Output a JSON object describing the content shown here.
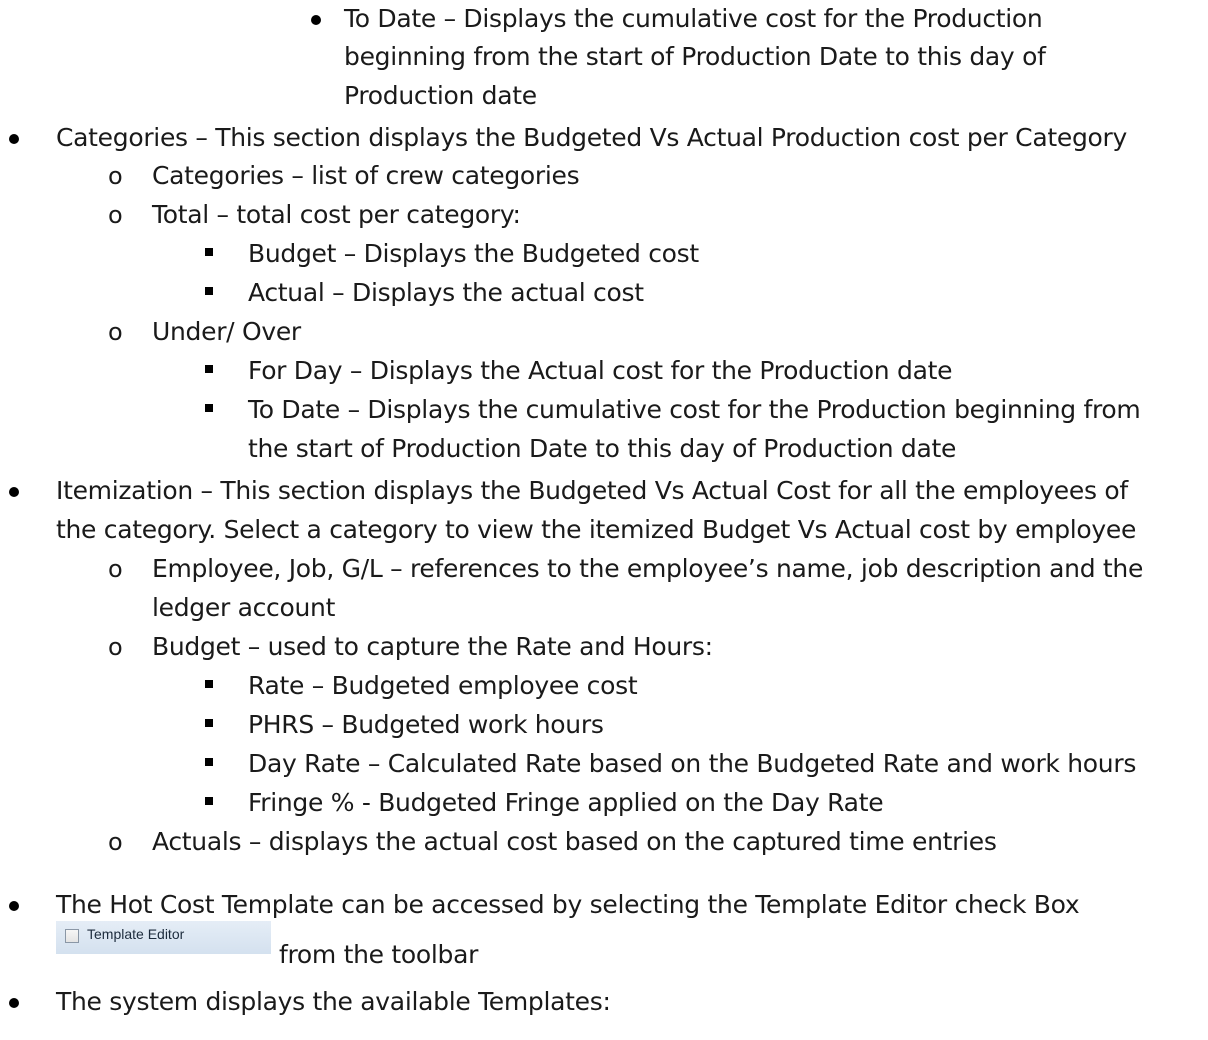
{
  "lines": {
    "l1": "To Date – Displays the cumulative cost for the Production",
    "l2": "beginning from the start of Production Date to this day of",
    "l3": "Production date",
    "l4": "Categories – This section displays the Budgeted Vs Actual Production cost per Category",
    "l5": "Categories – list of crew categories",
    "l6": "Total – total cost per category:",
    "l7": "Budget – Displays the Budgeted cost",
    "l8": "Actual – Displays the actual cost",
    "l9": "Under/ Over",
    "l10": "For Day – Displays the Actual cost for the Production date",
    "l11": "To Date – Displays the cumulative cost for the Production beginning from",
    "l12": "the start of Production Date to this day of Production date",
    "l13": "Itemization – This section displays the Budgeted Vs Actual Cost for all the employees of",
    "l14": "the category. Select a category to view the itemized Budget Vs Actual cost by employee",
    "l15": "Employee, Job, G/L – references to the employee’s name, job description and the",
    "l16": "ledger account",
    "l17": "Budget – used to capture the Rate and Hours:",
    "l18": "Rate – Budgeted employee cost",
    "l19": "PHRS – Budgeted work hours",
    "l20": "Day Rate – Calculated Rate based on the Budgeted Rate and work hours",
    "l21": "Fringe % - Budgeted Fringe applied on the Day Rate",
    "l22": "Actuals – displays the actual cost based on the captured time entries",
    "l23": "The Hot Cost Template can be accessed by selecting the Template Editor check Box",
    "l24": "from the toolbar",
    "l25": "The system displays the available Templates:"
  },
  "template_editor_checkbox": {
    "label": "Template Editor",
    "checked": false
  },
  "bullet_o": "o"
}
